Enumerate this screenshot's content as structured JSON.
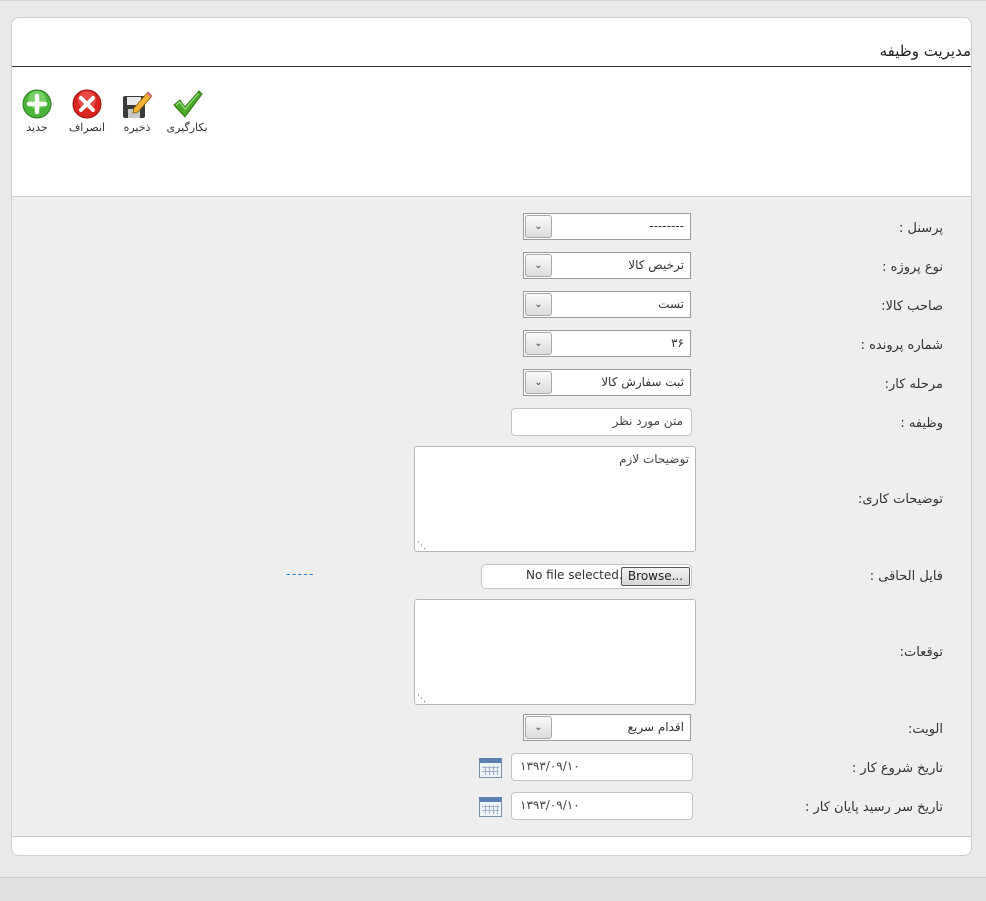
{
  "panel": {
    "title": "مدیریت وظیفه"
  },
  "toolbar": {
    "apply_label": "بکارگیری",
    "save_label": "ذخیره",
    "cancel_label": "انصراف",
    "new_label": "جدید"
  },
  "form": {
    "personnel": {
      "label": "پرسنل :",
      "value": "--------"
    },
    "project_type": {
      "label": "نوع پروژه :",
      "value": "ترخیص کالا"
    },
    "goods_owner": {
      "label": "صاحب کالا:",
      "value": "تست"
    },
    "file_number": {
      "label": "شماره پرونده :",
      "value": "۳۶"
    },
    "work_stage": {
      "label": "مرحله کار:",
      "value": "ثبت سفارش کالا"
    },
    "task": {
      "label": "وظیفه :",
      "value": "متن مورد نظر"
    },
    "work_description": {
      "label": "توضیحات کاری:",
      "value": "توضیحات لازم"
    },
    "attachment": {
      "label": "فایل الحاقی :",
      "browse_label": "Browse...",
      "status": "No file selected.",
      "link_text": "-----"
    },
    "expectations": {
      "label": "توقعات:",
      "value": ""
    },
    "priority": {
      "label": "الویت:",
      "value": "اقدام سریع"
    },
    "start_date": {
      "label": "تاریخ شروع کار :",
      "value": "۱۳۹۳/۰۹/۱۰"
    },
    "due_date": {
      "label": "تاریخ سر رسید پایان کار :",
      "value": "۱۳۹۳/۰۹/۱۰"
    }
  },
  "icons": {
    "apply": "checkmark-icon",
    "save": "floppy-pencil-icon",
    "cancel": "red-x-icon",
    "new": "green-plus-icon",
    "calendar": "calendar-icon"
  },
  "colors": {
    "apply": "#4aa82a",
    "cancel": "#d9241f",
    "new": "#4ab53a",
    "link": "#2b8ad8",
    "form_background": "#eeeeee"
  }
}
